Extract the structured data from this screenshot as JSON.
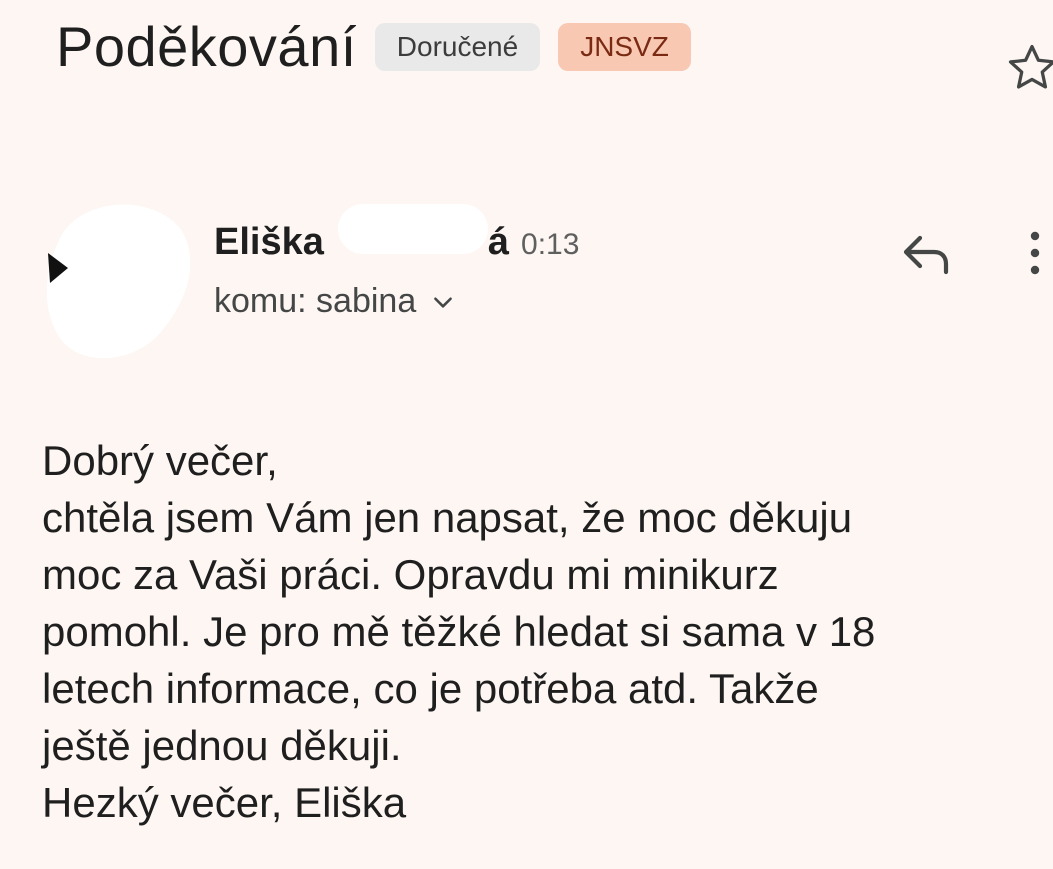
{
  "email": {
    "subject": "Poděkování",
    "labels": [
      "Doručené",
      "JNSVZ"
    ],
    "sender": {
      "first_name": "Eliška",
      "name_suffix": "á",
      "time": "0:13"
    },
    "recipient": "komu: sabina",
    "body_lines": [
      "Dobrý večer,",
      "chtěla jsem Vám jen napsat, že moc děkuju",
      "moc za Vaši práci. Opravdu mi minikurz",
      "pomohl. Je pro mě těžké hledat si sama v 18",
      "letech informace, co je potřeba atd. Takže",
      "ještě jednou děkuji.",
      "Hezký večer, Eliška"
    ]
  },
  "icons": {
    "star": "star-outline-icon",
    "reply": "reply-icon",
    "more": "more-vertical-icon",
    "expand": "chevron-down-icon"
  },
  "colors": {
    "background": "#fdf6f3",
    "label_chip": "#f8c8b3",
    "inbox_chip": "#e9e9e9"
  }
}
